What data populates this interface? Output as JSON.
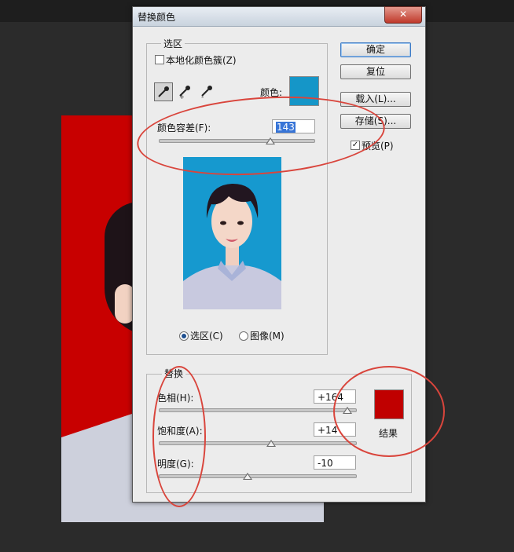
{
  "dialog": {
    "title": "替换颜色",
    "close_icon": "close-x-icon",
    "selection": {
      "group_label": "选区",
      "localized_clusters_label": "本地化颜色簇(Z)",
      "localized_clusters_checked": false,
      "tools": [
        "eyedropper-icon",
        "eyedropper-add-icon",
        "eyedropper-subtract-icon"
      ],
      "color_label": "颜色:",
      "color": "#1596c8",
      "fuzziness_label": "颜色容差(F):",
      "fuzziness_value": "143",
      "fuzziness_level": 0.71,
      "radio_selection_label": "选区(C)",
      "radio_image_label": "图像(M)",
      "selected_view": "selection"
    },
    "buttons": {
      "ok": "确定",
      "reset": "复位",
      "load": "载入(L)...",
      "save": "存储(S)..."
    },
    "preview_label": "预览(P)",
    "preview_checked": true,
    "replace": {
      "group_label": "替换",
      "hue_label": "色相(H):",
      "hue_value": "+164",
      "hue_level": 0.96,
      "saturation_label": "饱和度(A):",
      "saturation_value": "+14",
      "saturation_level": 0.57,
      "lightness_label": "明度(G):",
      "lightness_value": "-10",
      "lightness_level": 0.45,
      "result_label": "结果",
      "result_color": "#c00000"
    }
  }
}
